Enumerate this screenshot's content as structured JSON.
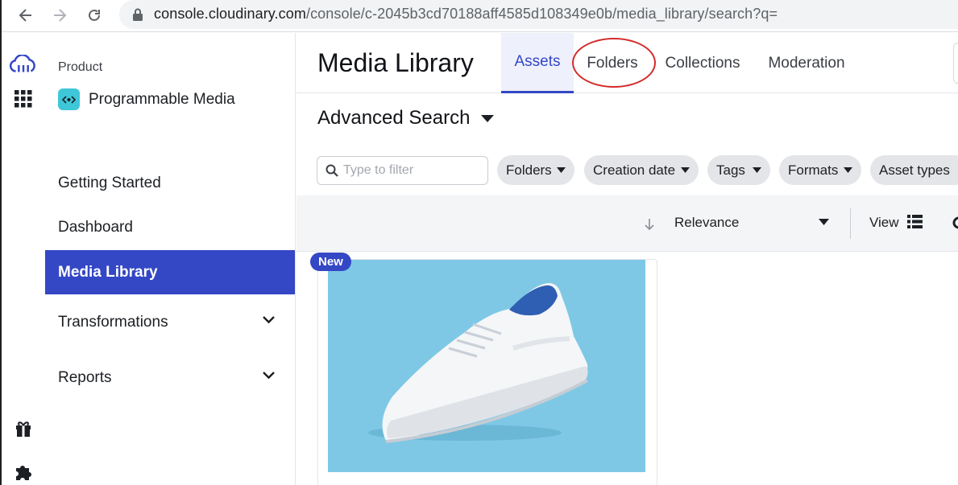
{
  "browser": {
    "url_host": "console.cloudinary.com",
    "url_path": "/console/c-2045b3cd70188aff4585d108349e0b/media_library/search?q="
  },
  "rail": {
    "icons": [
      "cloudinary-logo-icon",
      "apps-grid-icon",
      "gift-icon",
      "puzzle-icon"
    ]
  },
  "sidebar": {
    "product_label": "Product",
    "product_name": "Programmable Media",
    "items": [
      {
        "label": "Getting Started"
      },
      {
        "label": "Dashboard"
      },
      {
        "label": "Media Library",
        "active": true
      },
      {
        "label": "Transformations"
      },
      {
        "label": "Reports"
      }
    ]
  },
  "header": {
    "title": "Media Library",
    "tabs": [
      {
        "label": "Assets",
        "active": true
      },
      {
        "label": "Folders"
      },
      {
        "label": "Collections"
      },
      {
        "label": "Moderation"
      }
    ]
  },
  "search": {
    "title": "Advanced Search",
    "filter_placeholder": "Type to filter",
    "chips": [
      "Folders",
      "Creation date",
      "Tags",
      "Formats",
      "Asset types"
    ]
  },
  "sort": {
    "label": "Relevance",
    "view_label": "View"
  },
  "asset": {
    "badge": "New"
  },
  "colors": {
    "accent": "#3447c5",
    "thumb_bg": "#7ec8e6",
    "annotation": "#d42a2a"
  }
}
